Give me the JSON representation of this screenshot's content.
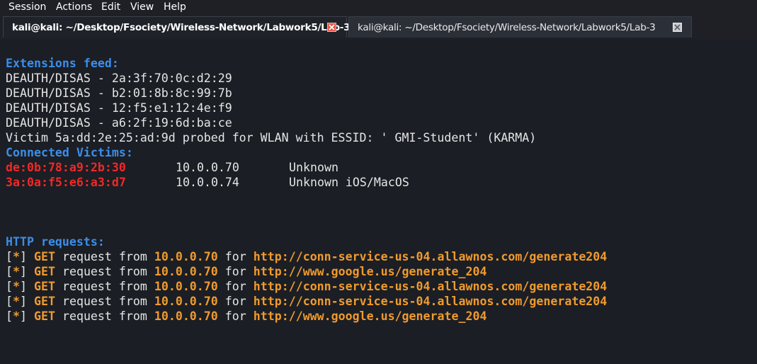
{
  "menu": [
    "Session",
    "Actions",
    "Edit",
    "View",
    "Help"
  ],
  "tabs": [
    {
      "label": "kali@kali: ~/Desktop/Fsociety/Wireless-Network/Labwork5/Lab-3",
      "active": true
    },
    {
      "label": "kali@kali: ~/Desktop/Fsociety/Wireless-Network/Labwork5/Lab-3",
      "active": false
    }
  ],
  "terminal": {
    "extensions_header": "Extensions feed:",
    "extension_lines": [
      "DEAUTH/DISAS - 2a:3f:70:0c:d2:29",
      "DEAUTH/DISAS - b2:01:8b:8c:99:7b",
      "DEAUTH/DISAS - 12:f5:e1:12:4e:f9",
      "DEAUTH/DISAS - a6:2f:19:6d:ba:ce",
      "Victim 5a:dd:2e:25:ad:9d probed for WLAN with ESSID: ' GMI-Student' (KARMA)"
    ],
    "victims_header": "Connected Victims:",
    "victims": [
      {
        "mac": "de:0b:78:a9:2b:30",
        "ip": "10.0.0.70",
        "vendor": "Unknown"
      },
      {
        "mac": "3a:0a:f5:e6:a3:d7",
        "ip": "10.0.0.74",
        "vendor": "Unknown iOS/MacOS"
      }
    ],
    "http_header": "HTTP requests:",
    "requests": [
      {
        "method": "GET",
        "from": "10.0.0.70",
        "url": "http://conn-service-us-04.allawnos.com/generate204"
      },
      {
        "method": "GET",
        "from": "10.0.0.70",
        "url": "http://www.google.us/generate_204"
      },
      {
        "method": "GET",
        "from": "10.0.0.70",
        "url": "http://conn-service-us-04.allawnos.com/generate204"
      },
      {
        "method": "GET",
        "from": "10.0.0.70",
        "url": "http://conn-service-us-04.allawnos.com/generate204"
      },
      {
        "method": "GET",
        "from": "10.0.0.70",
        "url": "http://www.google.us/generate_204"
      }
    ],
    "bracket_star": "[*]",
    "request_word": "request from",
    "for_word": "for"
  }
}
